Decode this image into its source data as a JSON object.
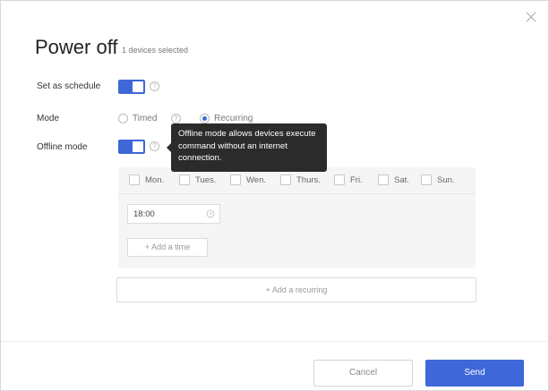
{
  "dialog": {
    "title": "Power off",
    "subtitle": "1 devices selected",
    "close_icon": "close-icon"
  },
  "form": {
    "schedule_label": "Set as schedule",
    "schedule_enabled": true,
    "mode_label": "Mode",
    "mode_options": [
      {
        "label": "Timed",
        "selected": false
      },
      {
        "label": "Recurring",
        "selected": true
      }
    ],
    "offline_label": "Offline mode",
    "offline_enabled": true
  },
  "tooltip": {
    "text": "Offline mode allows devices execute command without an internet connection."
  },
  "schedule": {
    "days": [
      {
        "label": "Mon.",
        "checked": false
      },
      {
        "label": "Tues.",
        "checked": false
      },
      {
        "label": "Wen.",
        "checked": false
      },
      {
        "label": "Thurs.",
        "checked": false
      },
      {
        "label": "Fri.",
        "checked": false
      },
      {
        "label": "Sat.",
        "checked": false
      },
      {
        "label": "Sun.",
        "checked": false
      }
    ],
    "time_value": "18:00",
    "add_time_label": "+ Add a time",
    "add_recurring_label": "+ Add a recurring"
  },
  "footer": {
    "cancel_label": "Cancel",
    "send_label": "Send"
  },
  "colors": {
    "accent": "#3e68d8",
    "tooltip_bg": "#2b2b2b"
  }
}
